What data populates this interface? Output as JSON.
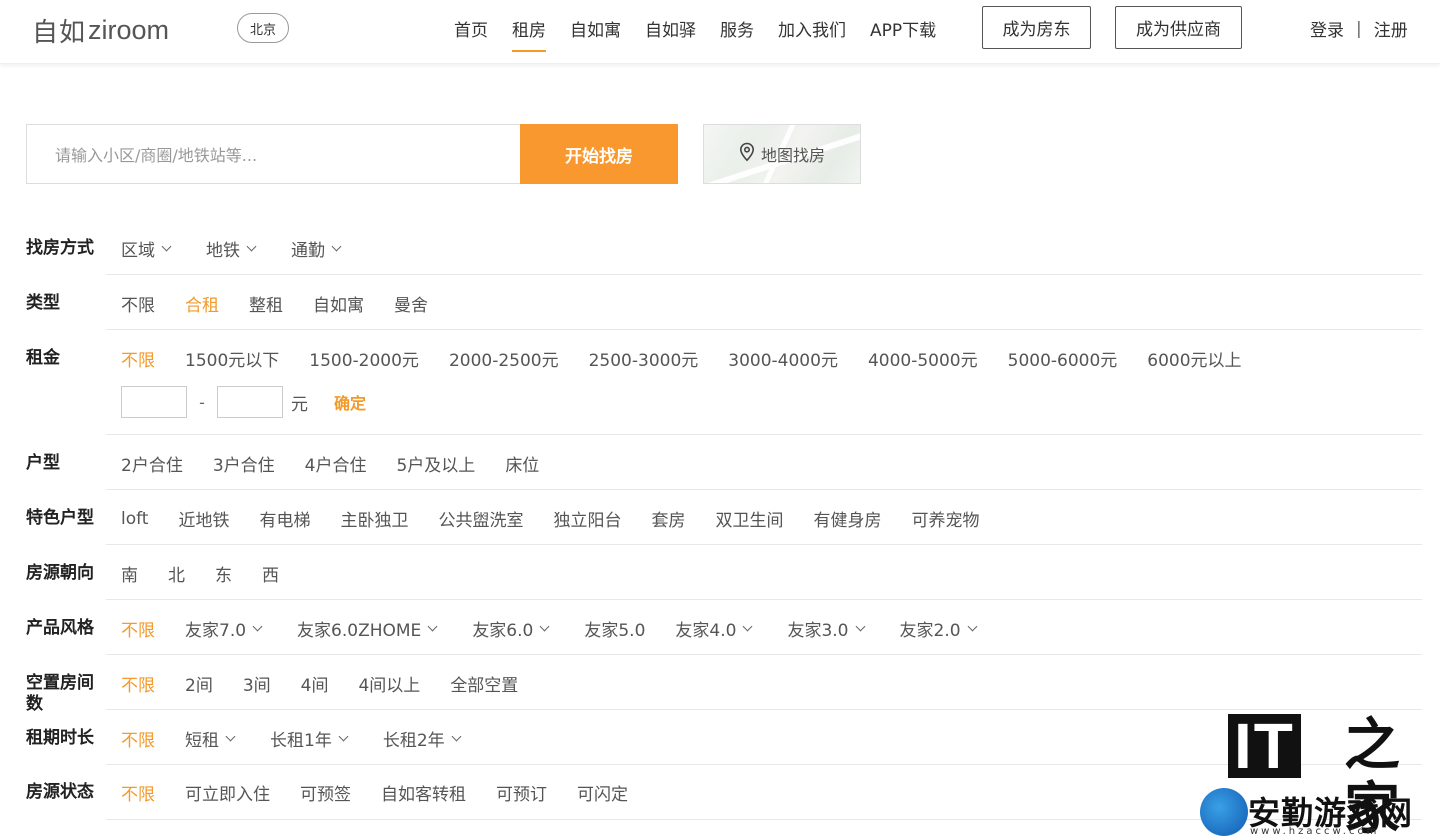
{
  "header": {
    "logo_cn": "自如",
    "logo_en": "ziroom",
    "city": "北京",
    "nav": [
      "首页",
      "租房",
      "自如寓",
      "自如驿",
      "服务",
      "加入我们",
      "APP下载"
    ],
    "nav_active_index": 1,
    "btn_landlord": "成为房东",
    "btn_supplier": "成为供应商",
    "login": "登录",
    "sep": "|",
    "register": "注册"
  },
  "search": {
    "placeholder": "请输入小区/商圈/地铁站等...",
    "button": "开始找房",
    "map_button": "地图找房"
  },
  "filters": {
    "method": {
      "label": "找房方式",
      "options": [
        "区域",
        "地铁",
        "通勤"
      ]
    },
    "type": {
      "label": "类型",
      "options": [
        "不限",
        "合租",
        "整租",
        "自如寓",
        "曼舍"
      ],
      "selected": 1
    },
    "rent": {
      "label": "租金",
      "options": [
        "不限",
        "1500元以下",
        "1500-2000元",
        "2000-2500元",
        "2500-3000元",
        "3000-4000元",
        "4000-5000元",
        "5000-6000元",
        "6000元以上"
      ],
      "selected": 0,
      "range_dash": "-",
      "unit": "元",
      "confirm": "确定"
    },
    "layout": {
      "label": "户型",
      "options": [
        "2户合住",
        "3户合住",
        "4户合住",
        "5户及以上",
        "床位"
      ]
    },
    "feature": {
      "label": "特色户型",
      "options": [
        "loft",
        "近地铁",
        "有电梯",
        "主卧独卫",
        "公共盥洗室",
        "独立阳台",
        "套房",
        "双卫生间",
        "有健身房",
        "可养宠物"
      ]
    },
    "orientation": {
      "label": "房源朝向",
      "options": [
        "南",
        "北",
        "东",
        "西"
      ]
    },
    "style": {
      "label": "产品风格",
      "options": [
        "不限",
        "友家7.0",
        "友家6.0ZHOME",
        "友家6.0",
        "友家5.0",
        "友家4.0",
        "友家3.0",
        "友家2.0"
      ],
      "selected": 0
    },
    "vacant": {
      "label": "空置房间数",
      "options": [
        "不限",
        "2间",
        "3间",
        "4间",
        "4间以上",
        "全部空置"
      ],
      "selected": 0
    },
    "lease": {
      "label": "租期时长",
      "options": [
        "不限",
        "短租",
        "长租1年",
        "长租2年"
      ],
      "selected": 0
    },
    "status": {
      "label": "房源状态",
      "options": [
        "不限",
        "可立即入住",
        "可预签",
        "自如客转租",
        "可预订",
        "可闪定"
      ],
      "selected": 0
    }
  },
  "watermark": {
    "it": "IT",
    "home": "之家",
    "text": "安勤游戏网",
    "url": "www.hzaccw.com"
  },
  "colors": {
    "accent": "#f39a2b",
    "search_button": "#f8982e"
  }
}
